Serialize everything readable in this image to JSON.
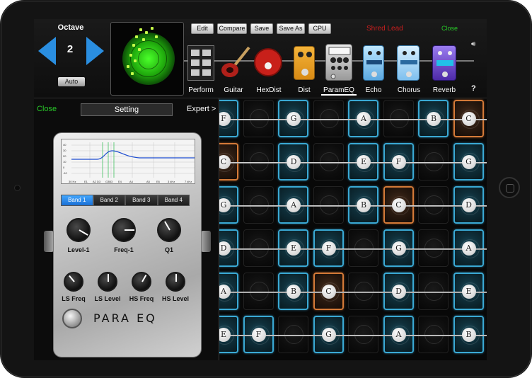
{
  "header": {
    "octave_label": "Octave",
    "octave_value": "2",
    "auto_label": "Auto",
    "buttons": [
      "Edit",
      "Compare",
      "Save",
      "Save As",
      "CPU"
    ],
    "patch_name": "Shred Lead",
    "close_label": "Close",
    "help_label": "?"
  },
  "chain": {
    "items": [
      {
        "label": "Perform",
        "icon": "grid-icon"
      },
      {
        "label": "Guitar",
        "icon": "guitar-icon"
      },
      {
        "label": "HexDist",
        "icon": "hexdist-pedal-icon"
      },
      {
        "label": "Dist",
        "icon": "dist-pedal-icon"
      },
      {
        "label": "ParamEQ",
        "icon": "parameq-pedal-icon"
      },
      {
        "label": "Echo",
        "icon": "echo-pedal-icon"
      },
      {
        "label": "Chorus",
        "icon": "chorus-pedal-icon"
      },
      {
        "label": "Reverb",
        "icon": "reverb-pedal-icon"
      }
    ]
  },
  "panel": {
    "close_label": "Close",
    "setting_label": "Setting",
    "expert_label": "Expert >"
  },
  "eq": {
    "bands": [
      "Band 1",
      "Band 2",
      "Band 3",
      "Band 4"
    ],
    "active_band": 0,
    "knobs": [
      "Level-1",
      "Freq-1",
      "Q1",
      "LS Freq",
      "LS Level",
      "HS Freq",
      "HS Level"
    ],
    "logo": "PARA EQ"
  },
  "fretboard": {
    "rows": [
      [
        "F",
        "",
        "G",
        "",
        "A",
        "",
        "B",
        "C"
      ],
      [
        "C",
        "",
        "D",
        "",
        "E",
        "F",
        "",
        "G"
      ],
      [
        "G",
        "",
        "A",
        "",
        "B",
        "C",
        "",
        "D"
      ],
      [
        "D",
        "",
        "E",
        "F",
        "",
        "G",
        "",
        "A"
      ],
      [
        "A",
        "",
        "B",
        "C",
        "",
        "D",
        "",
        "E"
      ],
      [
        "E",
        "F",
        "",
        "G",
        "",
        "A",
        "",
        "B"
      ]
    ],
    "highlighted": [
      [
        0,
        7
      ],
      [
        1,
        0
      ],
      [
        2,
        5
      ],
      [
        4,
        3
      ]
    ]
  },
  "colors": {
    "accent_blue": "#3aa9d4",
    "accent_orange": "#d47a38",
    "close_green": "#28c828",
    "patch_red": "#cc1e1e"
  }
}
